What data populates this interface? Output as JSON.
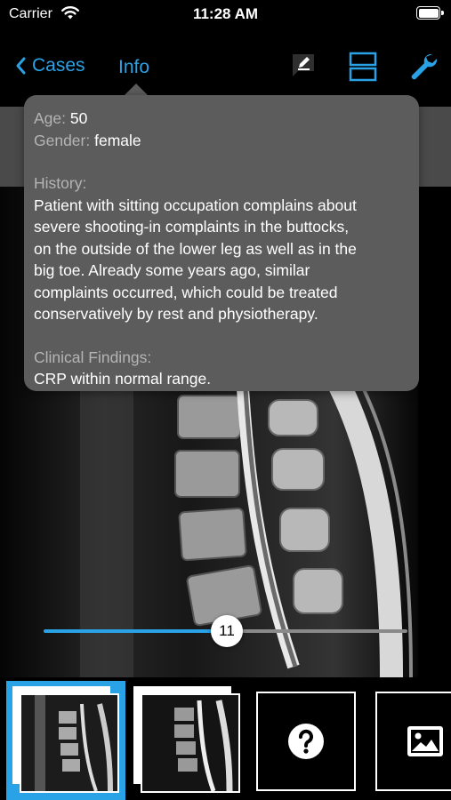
{
  "status_bar": {
    "carrier": "Carrier",
    "time": "11:28 AM"
  },
  "nav": {
    "back_label": "Cases",
    "info_label": "Info",
    "accent_color": "#2aa2e6",
    "icons": [
      "annotation-icon",
      "split-view-icon",
      "wrench-icon"
    ]
  },
  "info": {
    "age_key": "Age:",
    "age_value": "50",
    "gender_key": "Gender:",
    "gender_value": "female",
    "history_key": "History:",
    "history_lines": [
      "Patient with sitting occupation complains about",
      "severe shooting-in complaints in the buttocks,",
      "on the outside of the lower leg as well as in the",
      "big toe.  Already some years ago, similar",
      "complaints occurred, which could be treated",
      "conservatively by rest and physiotherapy."
    ],
    "findings_key": "Clinical Findings:",
    "findings_value": "CRP within normal range."
  },
  "slider": {
    "value": "11"
  },
  "thumbnails": [
    {
      "kind": "image",
      "selected": true
    },
    {
      "kind": "image",
      "selected": false
    },
    {
      "kind": "question-icon",
      "selected": false
    },
    {
      "kind": "image-icon",
      "selected": false
    }
  ]
}
